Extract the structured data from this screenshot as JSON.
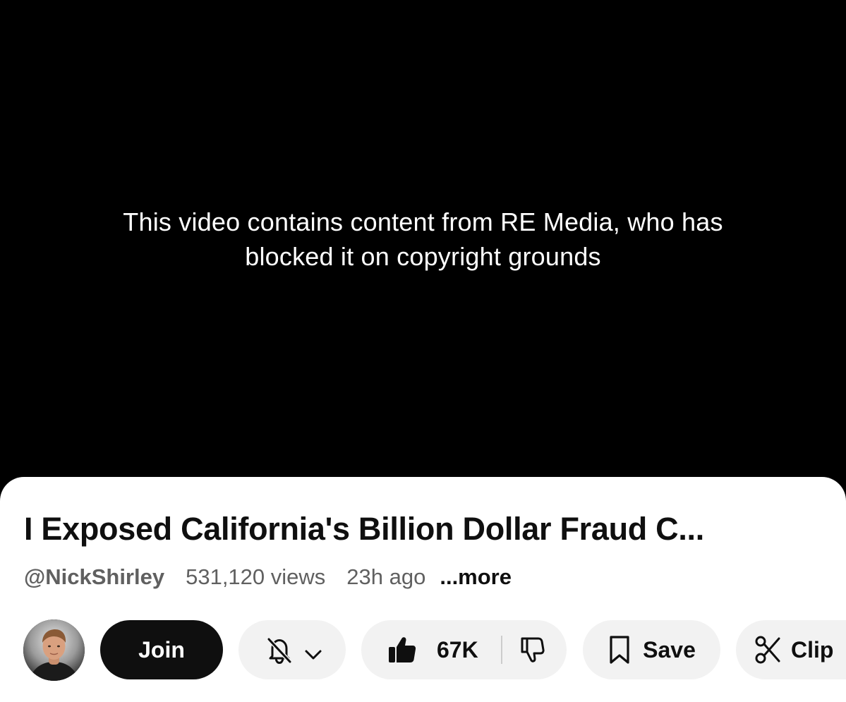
{
  "player": {
    "blocked_message": "This video contains content from RE Media, who has blocked it on copyright grounds",
    "blocked_line1": "This video contains content from RE Media, who has",
    "blocked_line2": "blocked it on copyright grounds"
  },
  "video": {
    "title": "I Exposed California's Billion Dollar Fraud C...",
    "channel_handle": "@NickShirley",
    "views": "531,120 views",
    "uploaded": "23h ago",
    "more_label": "...more"
  },
  "actions": {
    "join_label": "Join",
    "likes": "67K",
    "save_label": "Save",
    "clip_label": "Clip"
  },
  "icons": {
    "notify": "bell-off-icon",
    "notify_dropdown": "chevron-down-icon",
    "like": "thumbs-up-icon",
    "dislike": "thumbs-down-icon",
    "save": "bookmark-icon",
    "clip": "scissors-icon"
  },
  "colors": {
    "player_background": "#000000",
    "panel_background": "#ffffff",
    "title_text": "#0f0f0f",
    "meta_text": "#606060",
    "pill_background": "#f2f2f2",
    "join_background": "#0f0f0f",
    "join_text": "#ffffff"
  }
}
